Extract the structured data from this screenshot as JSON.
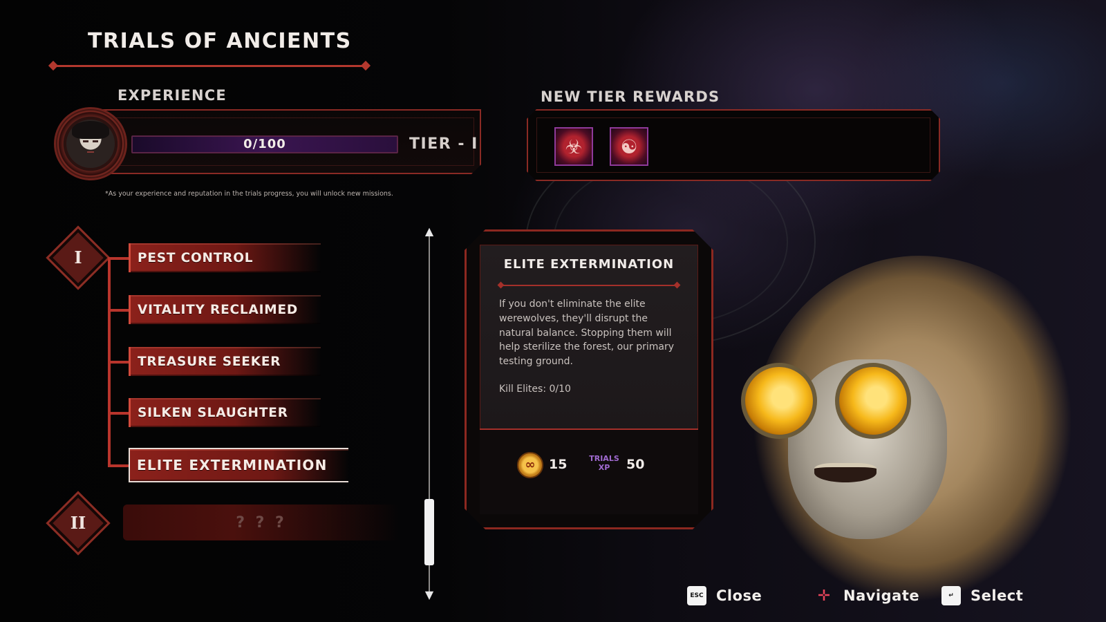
{
  "title": "TRIALS OF ANCIENTS",
  "experience": {
    "label": "EXPERIENCE",
    "value_text": "0/100",
    "progress": 0,
    "tier_label": "TIER - I",
    "note": "*As your experience and reputation in the trials progress, you will unlock new missions."
  },
  "rewards": {
    "label": "NEW TIER REWARDS",
    "items": [
      {
        "icon": "beast-maw-icon"
      },
      {
        "icon": "chain-bomb-icon"
      }
    ]
  },
  "tiers": [
    {
      "numeral": "I",
      "missions": [
        "PEST CONTROL",
        "VITALITY RECLAIMED",
        "TREASURE SEEKER",
        "SILKEN SLAUGHTER",
        "ELITE EXTERMINATION"
      ],
      "selected_index": 4
    },
    {
      "numeral": "II",
      "locked_label": "? ? ?"
    }
  ],
  "detail": {
    "title": "ELITE EXTERMINATION",
    "description": "If you don't eliminate the elite werewolves, they'll disrupt the natural balance. Stopping them will help sterilize the forest, our primary testing ground.",
    "objective": "Kill Elites: 0/10",
    "coin_reward": "15",
    "xp_label_top": "TRIALS",
    "xp_label_bottom": "XP",
    "xp_reward": "50"
  },
  "footer": {
    "close": {
      "key": "ESC",
      "label": "Close"
    },
    "navigate": {
      "label": "Navigate"
    },
    "select": {
      "label": "Select"
    }
  },
  "colors": {
    "accent": "#b3382e",
    "mission_fill": "#8b211b",
    "xp_purple": "#a06ad0"
  }
}
